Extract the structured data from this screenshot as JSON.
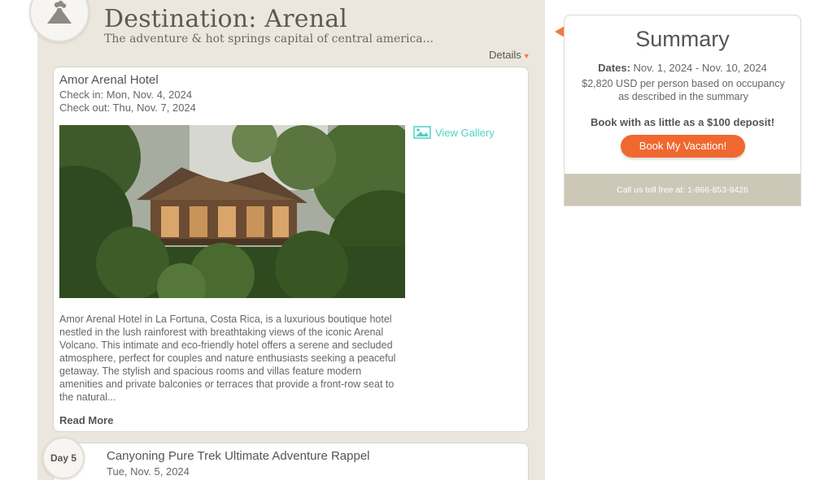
{
  "destination": {
    "title": "Destination: Arenal",
    "subtitle": "The adventure & hot springs capital of central america...",
    "details_label": "Details",
    "icon": "volcano-icon"
  },
  "hotel": {
    "name": "Amor Arenal Hotel",
    "check_in": "Check in: Mon, Nov. 4, 2024",
    "check_out": "Check out: Thu, Nov. 7, 2024",
    "gallery_label": "View Gallery",
    "description": "Amor Arenal Hotel in La Fortuna, Costa Rica, is a luxurious boutique hotel nestled in the lush rainforest with breathtaking views of the iconic Arenal Volcano. This intimate and eco-friendly hotel offers a serene and secluded atmosphere, perfect for couples and nature enthusiasts seeking a peaceful getaway. The stylish and spacious rooms and villas feature modern amenities and private balconies or terraces that provide a front-row seat to the natural...",
    "read_more": "Read More"
  },
  "day": {
    "badge": "Day 5",
    "activity_title": "Canyoning Pure Trek Ultimate Adventure Rappel",
    "activity_date": "Tue, Nov. 5, 2024"
  },
  "summary": {
    "title": "Summary",
    "dates_label": "Dates:",
    "dates_value": " Nov. 1, 2024 - Nov. 10, 2024",
    "price": "$2,820 USD per person based on occupancy as described in the summary",
    "deposit": "Book with as little as a $100 deposit!",
    "book_button": "Book My Vacation!",
    "phone": "Call us toll free at: 1-866-853-9426"
  },
  "colors": {
    "panel_bg": "#ebe7df",
    "accent_orange": "#f0682f",
    "gallery_teal": "#4fd1c5",
    "footer_bg": "#cdc7b8"
  }
}
